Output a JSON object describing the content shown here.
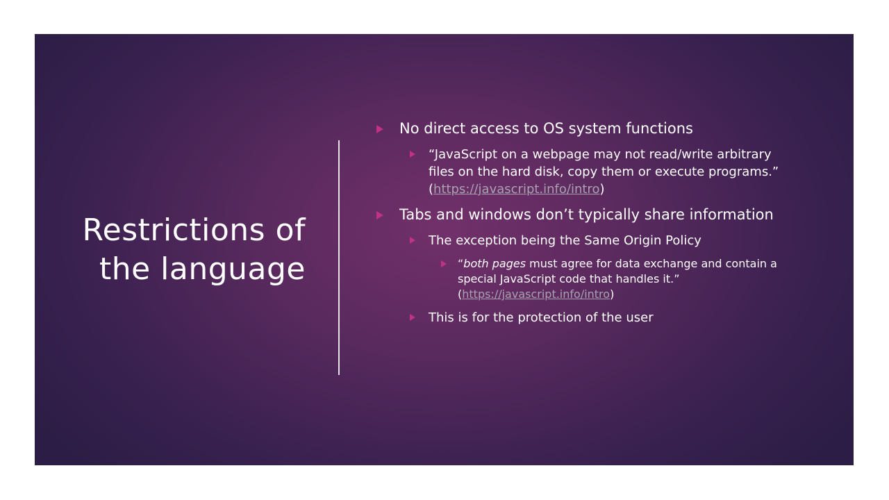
{
  "slide": {
    "title": "Restrictions of the language",
    "bullets": {
      "b1": "No direct access to OS system functions",
      "b1_1": {
        "text": "“JavaScript on a webpage may not read/write arbitrary files on the hard disk, copy them or execute programs.”",
        "open_paren": "(",
        "link": "https://javascript.info/intro",
        "close_paren": ")"
      },
      "b2": "Tabs and windows don’t typically share information",
      "b2_1": "The exception being the Same Origin Policy",
      "b2_1_1": {
        "open_quote": "“",
        "italic": "both pages",
        "text": " must agree for data exchange and contain a special JavaScript code that handles it.” (",
        "link": "https://javascript.info/intro",
        "close_paren": ")"
      },
      "b2_2": "This is for the protection of the user"
    }
  },
  "colors": {
    "bullet_accent": "#c2308a",
    "link": "#a8a2b0",
    "background_center": "#72306a",
    "background_edge": "#2b1d45"
  },
  "icons": {
    "bullet": "triangle-right-icon"
  }
}
